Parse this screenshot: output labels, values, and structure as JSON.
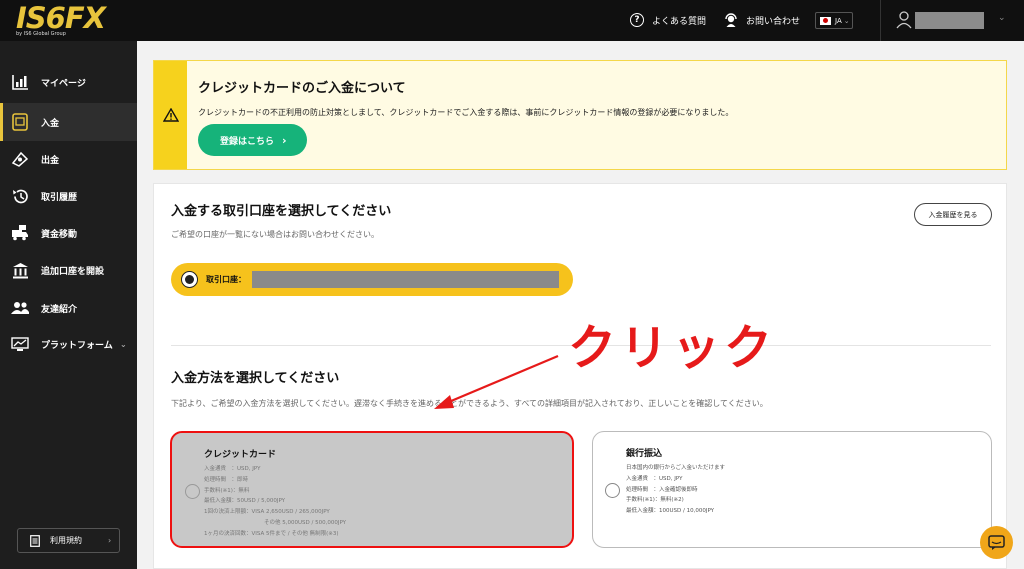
{
  "header": {
    "logo": "IS6FX",
    "logo_sub": "by IS6 Global Group",
    "faq": "よくある質問",
    "contact": "お問い合わせ",
    "lang": "JA"
  },
  "sidebar": {
    "items": [
      {
        "label": "マイページ",
        "icon": "bar-chart-icon"
      },
      {
        "label": "入金",
        "icon": "deposit-icon"
      },
      {
        "label": "出金",
        "icon": "withdraw-icon"
      },
      {
        "label": "取引履歴",
        "icon": "history-icon"
      },
      {
        "label": "資金移動",
        "icon": "transfer-icon"
      },
      {
        "label": "追加口座を開設",
        "icon": "bank-icon"
      },
      {
        "label": "友達紹介",
        "icon": "friends-icon"
      },
      {
        "label": "プラットフォーム",
        "icon": "platform-icon"
      }
    ],
    "terms": "利用規約"
  },
  "notice": {
    "title": "クレジットカードのご入金について",
    "body": "クレジットカードの不正利用の防止対策としまして、クレジットカードでご入金する際は、事前にクレジットカード情報の登録が必要になりました。",
    "button": "登録はこちら"
  },
  "account": {
    "title": "入金する取引口座を選択してください",
    "subtitle": "ご希望の口座が一覧にない場合はお問い合わせください。",
    "history_button": "入金履歴を見る",
    "label": "取引口座："
  },
  "method": {
    "title": "入金方法を選択してください",
    "subtitle": "下記より、ご希望の入金方法を選択してください。遅滞なく手続きを進めることができるよう、すべての詳細項目が記入されており、正しいことを確認してください。",
    "credit": {
      "title": "クレジットカード",
      "lines": [
        "入金通貨　：USD, JPY",
        "処理時間　：即時",
        "手数料(※1)：無料",
        "最低入金額：50USD / 5,000JPY",
        "1回の決済上限額：VISA 2,650USD / 265,000JPY",
        "その他 5,000USD / 500,000JPY",
        "1ヶ月の決済回数：VISA 5件まで / その他 無制限(※3)"
      ]
    },
    "bank": {
      "title": "銀行振込",
      "lines": [
        "日本国内の銀行からご入金いただけます",
        "入金通貨　：USD, JPY",
        "処理時間　：入金確認後即時",
        "手数料(※1)：無料(※2)",
        "最低入金額：100USD / 10,000JPY"
      ]
    }
  },
  "annotation": "クリック"
}
